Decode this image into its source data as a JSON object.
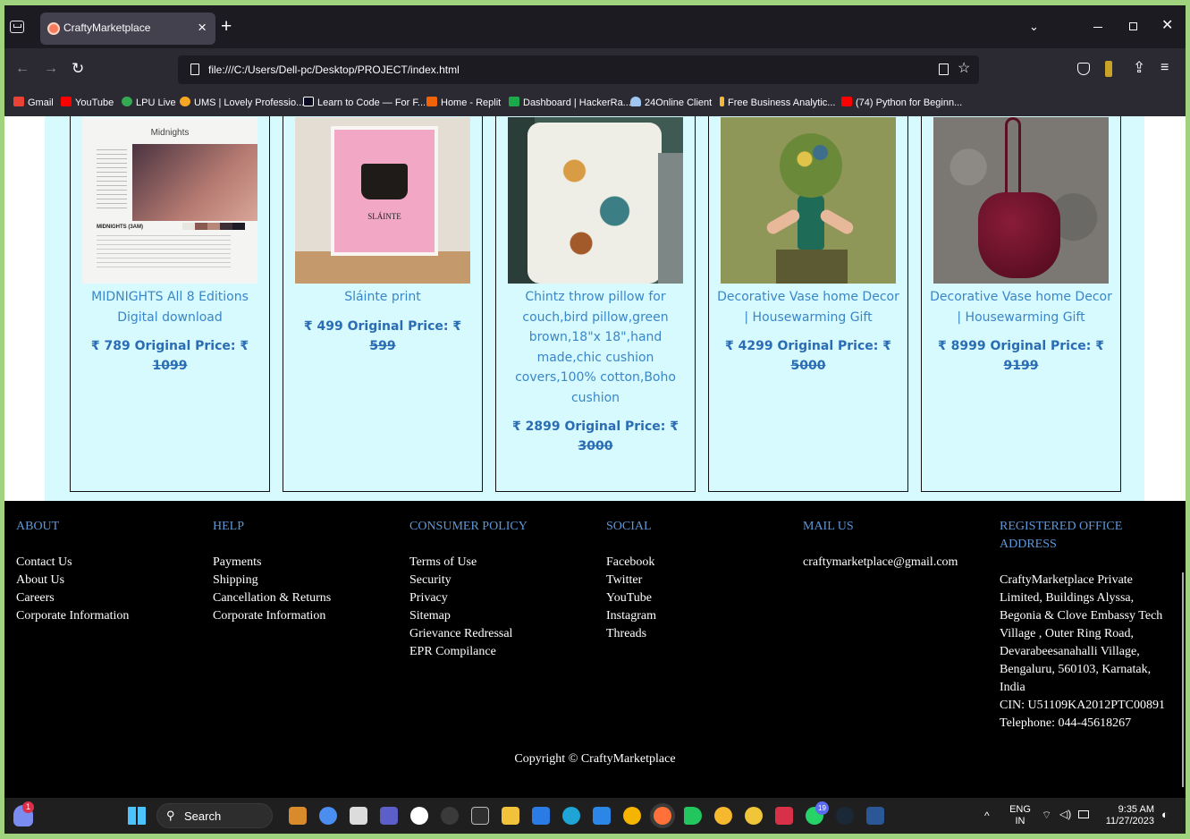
{
  "browser": {
    "tab_title": "CraftyMarketplace",
    "tab_close": "×",
    "new_tab": "+",
    "url": "file:///C:/Users/Dell-pc/Desktop/PROJECT/index.html",
    "bookmarks": [
      {
        "label": "Gmail",
        "color": "#ea4335"
      },
      {
        "label": "YouTube",
        "color": "#ff0000"
      },
      {
        "label": "LPU Live",
        "color": "#34a853"
      },
      {
        "label": "UMS | Lovely Professio...",
        "color": "#f5a623"
      },
      {
        "label": "Learn to Code — For F...",
        "color": "#0a0a23"
      },
      {
        "label": "Home - Replit",
        "color": "#f26207"
      },
      {
        "label": "Dashboard | HackerRa...",
        "color": "#1ba94c"
      },
      {
        "label": "24Online Client",
        "color": "#9ec6f0"
      },
      {
        "label": "Free Business Analytic...",
        "color": "#f3b93a"
      },
      {
        "label": "(74) Python for Beginn...",
        "color": "#ff0000"
      }
    ]
  },
  "products": [
    {
      "title": "MIDNIGHTS All 8 Editions Digital download",
      "price": "₹ 789 Original Price: ₹",
      "original": "1099"
    },
    {
      "title": "Sláinte print",
      "price": "₹ 499 Original Price: ₹",
      "original": "599"
    },
    {
      "title": "Chintz throw pillow for couch,bird pillow,green brown,18\"x 18\",hand made,chic cushion covers,100% cotton,Boho cushion",
      "price": "₹ 2899 Original Price: ₹",
      "original": "3000"
    },
    {
      "title": "Decorative Vase home Decor | Housewarming Gift",
      "price": "₹ 4299 Original Price: ₹",
      "original": "5000"
    },
    {
      "title": "Decorative Vase home Decor | Housewarming Gift",
      "price": "₹ 8999 Original Price: ₹",
      "original": "9199"
    }
  ],
  "images": {
    "album_heading": "Midnights",
    "album_caption": "MIDNIGHTS (3AM)",
    "print_caption": "SLÁINTE"
  },
  "footer": {
    "about": {
      "heading": "ABOUT",
      "links": [
        "Contact Us",
        "About Us",
        "Careers",
        "Corporate Information"
      ]
    },
    "help": {
      "heading": "HELP",
      "links": [
        "Payments",
        "Shipping",
        "Cancellation & Returns",
        "Corporate Information"
      ]
    },
    "policy": {
      "heading": "CONSUMER POLICY",
      "links": [
        "Terms of Use",
        "Security",
        "Privacy",
        "Sitemap",
        "Grievance Redressal",
        "EPR Compilance"
      ]
    },
    "social": {
      "heading": "SOCIAL",
      "links": [
        "Facebook",
        "Twitter",
        "YouTube",
        "Instagram",
        "Threads"
      ]
    },
    "mail": {
      "heading": "MAIL US",
      "email": "craftymarketplace@gmail.com"
    },
    "office": {
      "heading": "REGISTERED OFFICE ADDRESS",
      "address": "CraftyMarketplace Private Limited, Buildings Alyssa, Begonia & Clove Embassy Tech Village , Outer Ring Road, Devarabeesanahalli Village, Bengaluru, 560103, Karnatak, India",
      "cin": "CIN: U51109KA2012PTC00891",
      "phone": "Telephone: 044-45618267"
    },
    "copyright": "Copyright © CraftyMarketplace"
  },
  "taskbar": {
    "search": "Search",
    "lang_top": "ENG",
    "lang_bottom": "IN",
    "time": "9:35 AM",
    "date": "11/27/2023",
    "user_badge": "1",
    "whatsapp_badge": "19"
  },
  "colors": {
    "accent_blue": "#3a86c8",
    "price_blue": "#2a6db4",
    "footer_heading": "#5e98d8",
    "product_bg": "#d6fafd"
  }
}
